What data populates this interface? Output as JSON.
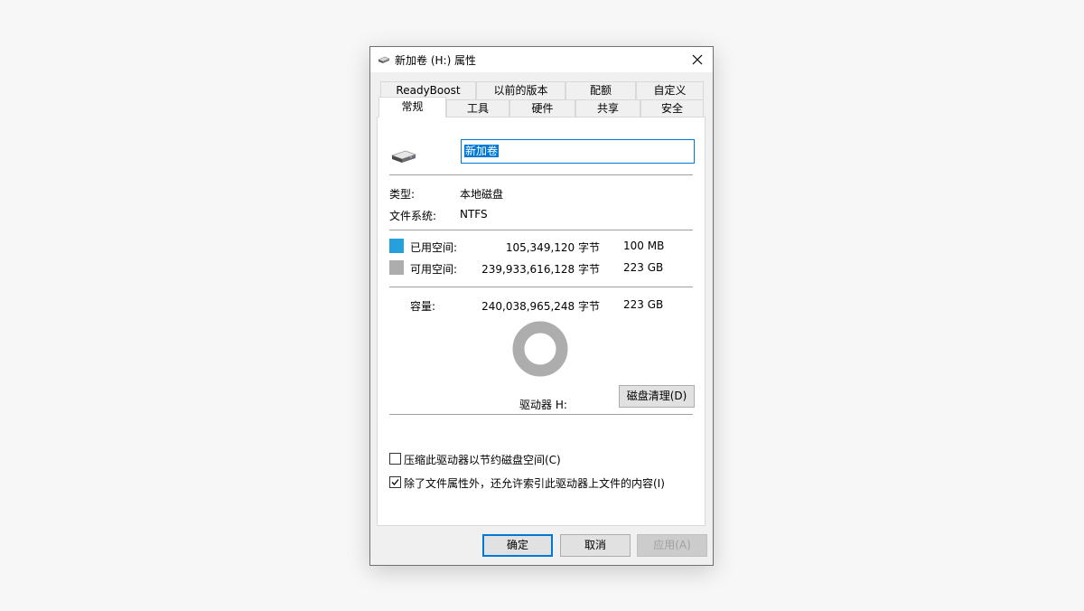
{
  "window": {
    "title": "新加卷 (H:) 属性",
    "icon": "drive-icon",
    "close_icon": "close-icon"
  },
  "tabs_top": [
    {
      "label": "ReadyBoost"
    },
    {
      "label": "以前的版本"
    },
    {
      "label": "配额"
    },
    {
      "label": "自定义"
    }
  ],
  "tabs_bottom": [
    {
      "label": "常规",
      "active": true
    },
    {
      "label": "工具"
    },
    {
      "label": "硬件"
    },
    {
      "label": "共享"
    },
    {
      "label": "安全"
    }
  ],
  "general": {
    "volume_name": "新加卷",
    "type_label": "类型:",
    "type_value": "本地磁盘",
    "fs_label": "文件系统:",
    "fs_value": "NTFS",
    "used": {
      "label": "已用空间:",
      "bytes": "105,349,120 字节",
      "size": "100 MB",
      "color": "#26a0da"
    },
    "free": {
      "label": "可用空间:",
      "bytes": "239,933,616,128 字节",
      "size": "223 GB",
      "color": "#adadad"
    },
    "capacity": {
      "label": "容量:",
      "bytes": "240,038,965,248 字节",
      "size": "223 GB"
    },
    "used_fraction": 0.0004,
    "drive_label": "驱动器 H:",
    "cleanup_button": "磁盘清理(D)",
    "compress_label": "压缩此驱动器以节约磁盘空间(C)",
    "compress_checked": false,
    "index_label": "除了文件属性外，还允许索引此驱动器上文件的内容(I)",
    "index_checked": true
  },
  "footer": {
    "ok": "确定",
    "cancel": "取消",
    "apply": "应用(A)"
  },
  "colors": {
    "accent": "#0078d7",
    "used": "#26a0da",
    "free": "#adadad"
  }
}
